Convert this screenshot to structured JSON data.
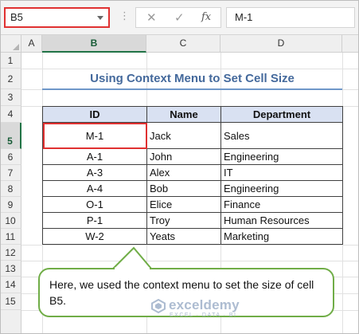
{
  "formula_bar": {
    "name_box": "B5",
    "cancel_icon": "✕",
    "enter_icon": "✓",
    "fx_label": "fx",
    "formula_value": "M-1"
  },
  "columns": [
    "A",
    "B",
    "C",
    "D"
  ],
  "rows": [
    "1",
    "2",
    "3",
    "4",
    "5",
    "6",
    "7",
    "8",
    "9",
    "10",
    "11",
    "12",
    "13",
    "14",
    "15"
  ],
  "title": "Using Context Menu to Set Cell Size",
  "table": {
    "headers": [
      "ID",
      "Name",
      "Department"
    ],
    "rows": [
      [
        "M-1",
        "Jack",
        "Sales"
      ],
      [
        "A-1",
        "John",
        "Engineering"
      ],
      [
        "A-3",
        "Alex",
        "IT"
      ],
      [
        "A-4",
        "Bob",
        "Engineering"
      ],
      [
        "O-1",
        "Elice",
        "Finance"
      ],
      [
        "P-1",
        "Troy",
        "Human Resources"
      ],
      [
        "W-2",
        "Yeats",
        "Marketing"
      ]
    ]
  },
  "callout": {
    "text": "Here, we used the context menu to set the size of cell B5."
  },
  "watermark": {
    "name": "exceldemy",
    "tagline": "EXCEL · DATA · BI"
  },
  "colors": {
    "selection_red": "#e03131",
    "excel_green": "#217346",
    "header_fill": "#d9e1f2",
    "title_blue": "#44699c",
    "callout_border": "#70ad47"
  }
}
